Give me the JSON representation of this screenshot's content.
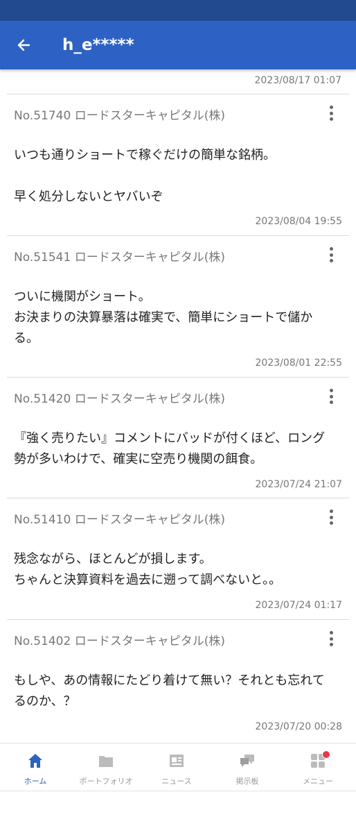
{
  "header": {
    "title": "h_e*****"
  },
  "feed": {
    "top_timestamp": "2023/08/17 01:07",
    "posts": [
      {
        "number": "No.51740 ロードスターキャピタル(株)",
        "lines": [
          "いつも通りショートで稼ぐだけの簡単な銘柄。",
          "",
          "早く処分しないとヤバいぞ"
        ],
        "timestamp": "2023/08/04 19:55"
      },
      {
        "number": "No.51541 ロードスターキャピタル(株)",
        "lines": [
          "ついに機関がショート。",
          "お決まりの決算暴落は確実で、簡単にショートで儲か",
          "る。"
        ],
        "timestamp": "2023/08/01 22:55"
      },
      {
        "number": "No.51420 ロードスターキャピタル(株)",
        "lines": [
          "『強く売りたい』コメントにバッドが付くほど、ロング",
          "勢が多いわけで、確実に空売り機関の餌食。"
        ],
        "timestamp": "2023/07/24 21:07"
      },
      {
        "number": "No.51410 ロードスターキャピタル(株)",
        "lines": [
          "残念ながら、ほとんどが損します。",
          "ちゃんと決算資料を過去に遡って調べないと。。"
        ],
        "timestamp": "2023/07/24 01:17"
      },
      {
        "number": "No.51402 ロードスターキャピタル(株)",
        "lines": [
          "もしや、あの情報にたどり着けて無い？それとも忘れて",
          "るのか、？"
        ],
        "timestamp": "2023/07/20 00:28"
      }
    ]
  },
  "bottom_nav": {
    "items": [
      {
        "label": "ホーム",
        "icon": "home-icon",
        "active": true
      },
      {
        "label": "ポートフォリオ",
        "icon": "folder-icon",
        "active": false
      },
      {
        "label": "ニュース",
        "icon": "newspaper-icon",
        "active": false
      },
      {
        "label": "掲示板",
        "icon": "chat-bubbles-icon",
        "active": false
      },
      {
        "label": "メニュー",
        "icon": "grid-menu-icon",
        "active": false,
        "badge": true
      }
    ]
  },
  "colors": {
    "appbar": "#2d62c4",
    "statusbar": "#224a8f",
    "active": "#2d62c4",
    "inactive": "#bbbbbb",
    "badge": "#e23b4c"
  }
}
